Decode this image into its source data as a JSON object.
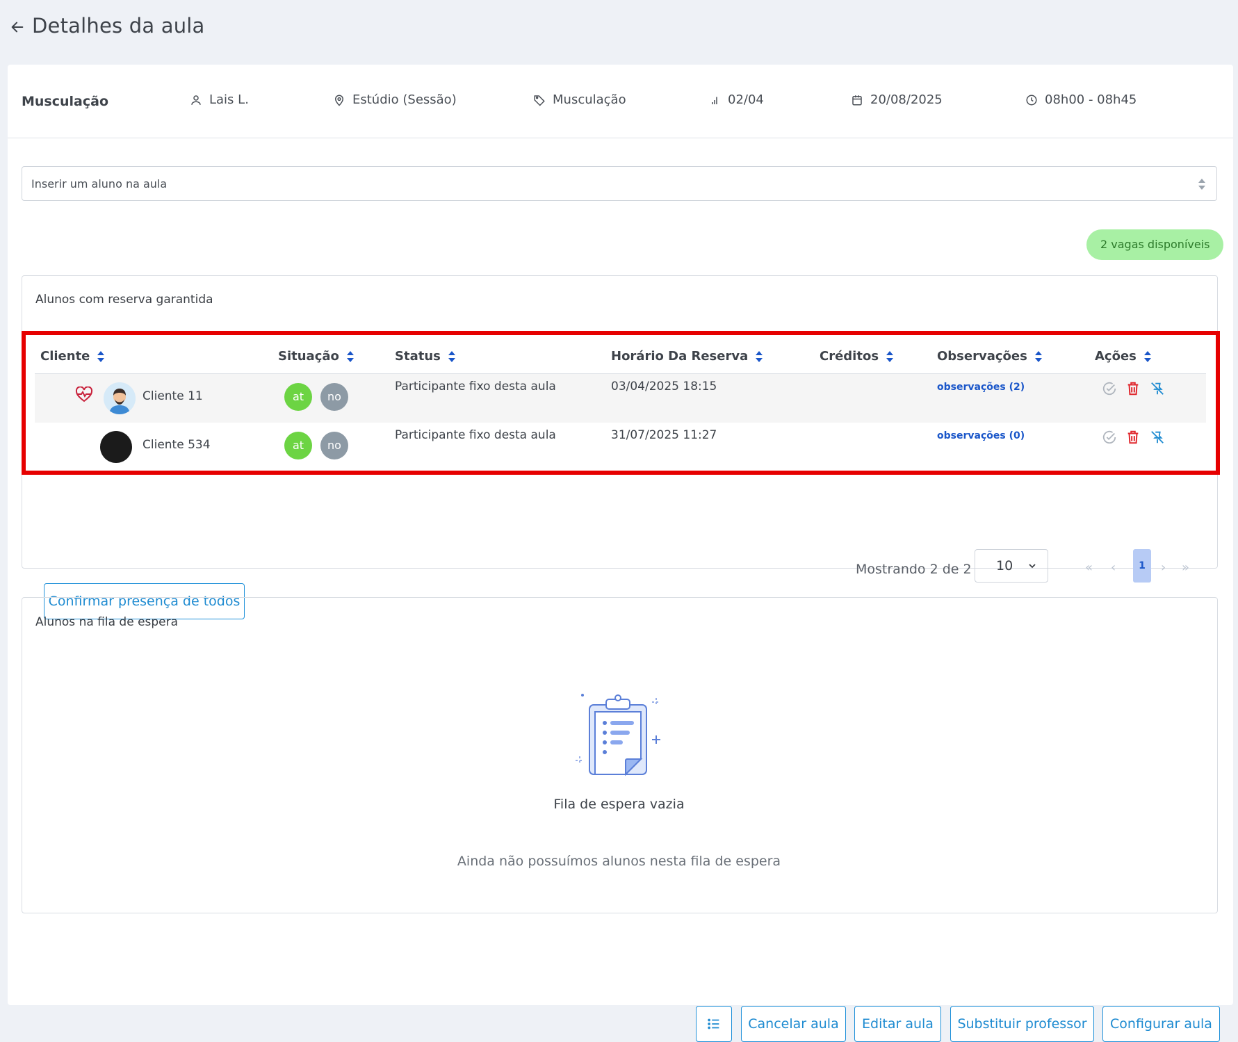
{
  "header": {
    "title": "Detalhes da aula"
  },
  "info": {
    "class_name": "Musculação",
    "teacher": "Lais L.",
    "location": "Estúdio (Sessão)",
    "category": "Musculação",
    "occupancy": "02/04",
    "date": "20/08/2025",
    "time": "08h00 - 08h45"
  },
  "search": {
    "placeholder": "Inserir um aluno na aula"
  },
  "vagas_badge": "2 vagas disponíveis",
  "reservations": {
    "title": "Alunos com reserva garantida",
    "columns": [
      "Cliente",
      "Situação",
      "Status",
      "Horário Da Reserva",
      "Créditos",
      "Observações",
      "Ações"
    ],
    "rows": [
      {
        "client": "Cliente 11",
        "sit_a": "at",
        "sit_b": "no",
        "status": "Participante fixo desta aula",
        "time": "03/04/2025 18:15",
        "credits": "",
        "obs": "observações (2)"
      },
      {
        "client": "Cliente 534",
        "sit_a": "at",
        "sit_b": "no",
        "status": "Participante fixo desta aula",
        "time": "31/07/2025 11:27",
        "credits": "",
        "obs": "observações (0)"
      }
    ],
    "showing": "Mostrando 2 de 2",
    "page_size": "10",
    "current_page": "1",
    "pager": {
      "first": "«",
      "prev": "‹",
      "next": "›",
      "last": "»"
    },
    "confirm_all": "Confirmar presença de todos"
  },
  "waitlist": {
    "title": "Alunos na fila de espera",
    "empty_title": "Fila de espera vazia",
    "empty_sub": "Ainda não possuímos alunos nesta fila de espera"
  },
  "actions": {
    "cancel": "Cancelar aula",
    "edit": "Editar aula",
    "replace": "Substituir professor",
    "configure": "Configurar aula"
  },
  "colors": {
    "accent": "#1e8bd1",
    "success_badge": "#a8f0a4",
    "at_green": "#6cd443",
    "no_grey": "#8d9aa5",
    "delete_red": "#e0282e",
    "highlight": "#e60000"
  }
}
